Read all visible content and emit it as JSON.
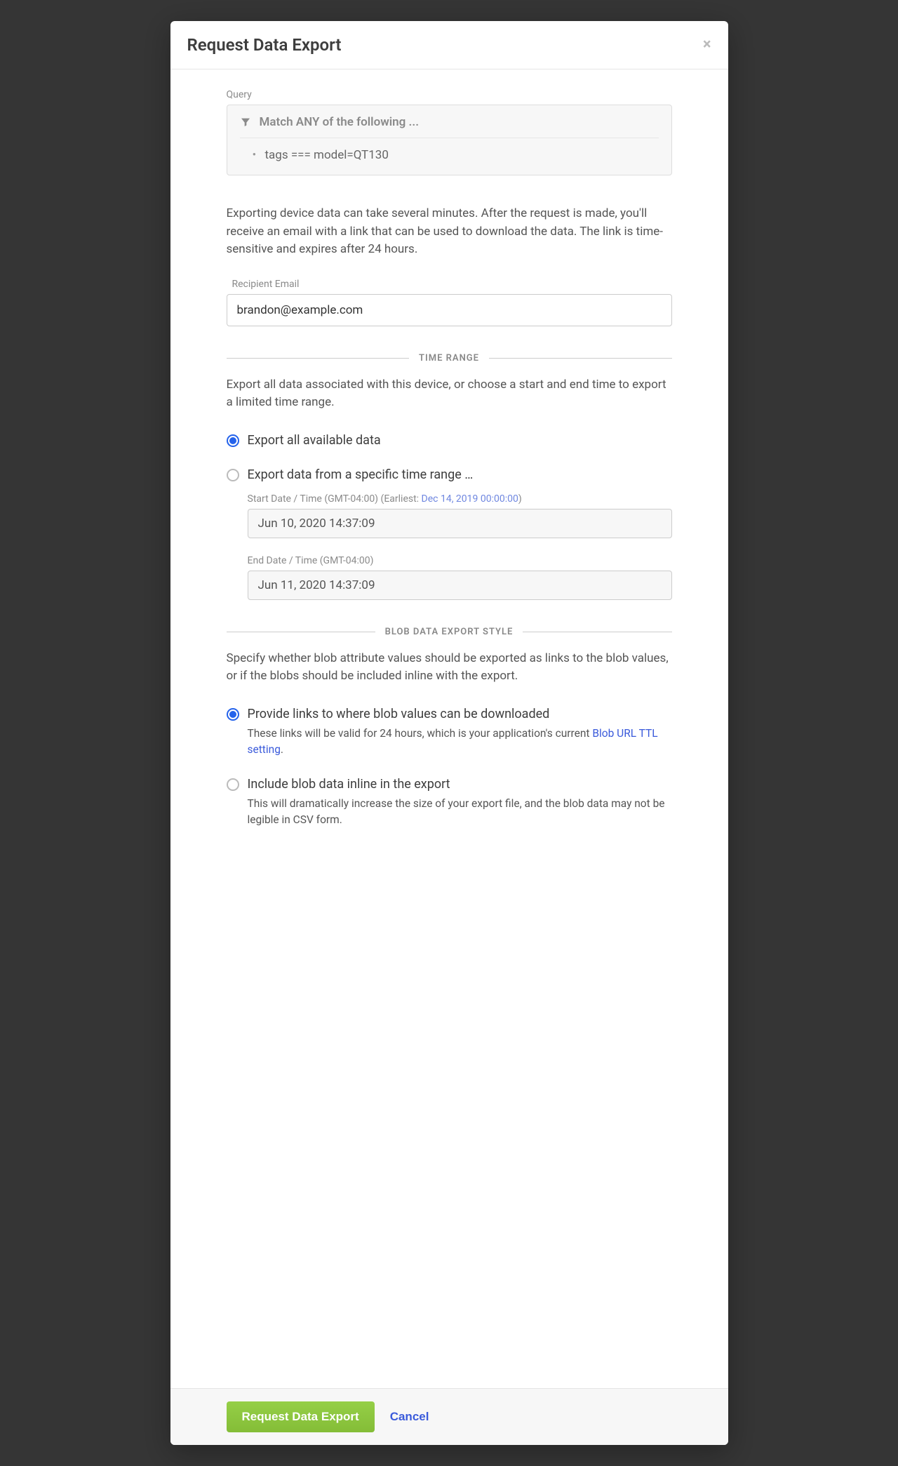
{
  "modal": {
    "title": "Request Data Export",
    "close_icon": "×"
  },
  "query": {
    "label": "Query",
    "match_text": "Match ANY of the following ...",
    "items": [
      "tags === model=QT130"
    ]
  },
  "export_note": "Exporting device data can take several minutes. After the request is made, you'll receive an email with a link that can be used to download the data. The link is time-sensitive and expires after 24 hours.",
  "recipient": {
    "label": "Recipient Email",
    "value": "brandon@example.com"
  },
  "time_range": {
    "divider": "TIME RANGE",
    "description": "Export all data associated with this device, or choose a start and end time to export a limited time range.",
    "option_all": "Export all available data",
    "option_range": "Export data from a specific time range …",
    "start_label_prefix": "Start Date / Time (GMT-04:00) (Earliest: ",
    "start_label_link": "Dec 14, 2019 00:00:00",
    "start_label_suffix": ")",
    "start_value": "Jun 10, 2020 14:37:09",
    "end_label": "End Date / Time (GMT-04:00)",
    "end_value": "Jun 11, 2020 14:37:09"
  },
  "blob": {
    "divider": "BLOB DATA EXPORT STYLE",
    "description": "Specify whether blob attribute values should be exported as links to the blob values, or if the blobs should be included inline with the export.",
    "option_links": "Provide links to where blob values can be downloaded",
    "option_links_help_prefix": "These links will be valid for 24 hours, which is your application's current ",
    "option_links_help_link": "Blob URL TTL setting",
    "option_links_help_suffix": ".",
    "option_inline": "Include blob data inline in the export",
    "option_inline_help": "This will dramatically increase the size of your export file, and the blob data may not be legible in CSV form."
  },
  "footer": {
    "submit": "Request Data Export",
    "cancel": "Cancel"
  }
}
